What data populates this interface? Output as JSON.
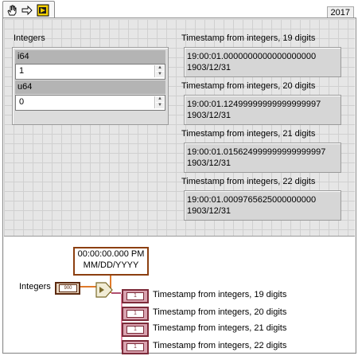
{
  "version": "2017",
  "tab_icons": [
    "hand-icon",
    "arrow-icon",
    "vi-icon"
  ],
  "front_panel": {
    "cluster": {
      "label": "Integers",
      "fields": [
        {
          "name": "i64",
          "value": "1"
        },
        {
          "name": "u64",
          "value": "0"
        }
      ]
    },
    "indicators": [
      {
        "label": "Timestamp from integers, 19 digits",
        "time": "19:00:01.0000000000000000000",
        "date": "1903/12/31"
      },
      {
        "label": "Timestamp from integers, 20 digits",
        "time": "19:00:01.12499999999999999997",
        "date": "1903/12/31"
      },
      {
        "label": "Timestamp from integers, 21 digits",
        "time": "19:00:01.015624999999999999997",
        "date": "1903/12/31"
      },
      {
        "label": "Timestamp from integers, 22 digits",
        "time": "19:00:01.0009765625000000000",
        "date": "1903/12/31"
      }
    ]
  },
  "block_diagram": {
    "constant_line1": "00:00:00.000 PM",
    "constant_line2": "MM/DD/YYYY",
    "control_label": "Integers",
    "control_glyph": "900",
    "terminal_glyph": "1",
    "terminals": [
      "Timestamp from integers, 19 digits",
      "Timestamp from integers, 20 digits",
      "Timestamp from integers, 21 digits",
      "Timestamp from integers, 22 digits"
    ]
  }
}
